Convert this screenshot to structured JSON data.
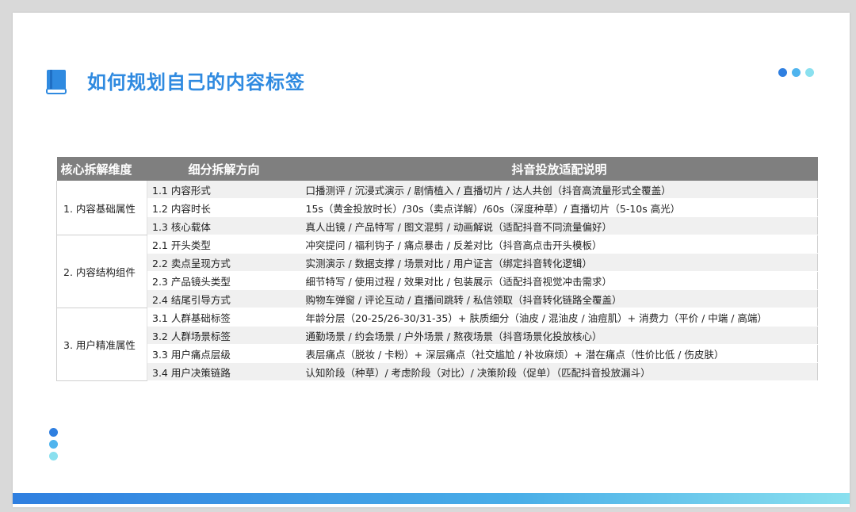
{
  "title": "如何规划自己的内容标签",
  "colors": {
    "accent": "#2f8ae0",
    "dot1": "#2f7fe0",
    "dot2": "#4fb4ee",
    "dot3": "#8ae0ef",
    "header_bg": "#7f7f7f"
  },
  "icons": {
    "title_icon": "book-icon"
  },
  "table": {
    "headers": [
      "核心拆解维度",
      "细分拆解方向",
      "抖音投放适配说明"
    ],
    "groups": [
      {
        "label": "1. 内容基础属性",
        "rows": [
          {
            "sub": "1.1 内容形式",
            "desc": "口播测评 / 沉浸式演示 / 剧情植入 / 直播切片 / 达人共创（抖音高流量形式全覆盖）"
          },
          {
            "sub": "1.2 内容时长",
            "desc": "15s（黄金投放时长）/30s（卖点详解）/60s（深度种草）/ 直播切片（5-10s 高光）"
          },
          {
            "sub": "1.3 核心载体",
            "desc": "真人出镜 / 产品特写 / 图文混剪 / 动画解说（适配抖音不同流量偏好）"
          }
        ]
      },
      {
        "label": "2. 内容结构组件",
        "rows": [
          {
            "sub": "2.1 开头类型",
            "desc": "冲突提问 / 福利钩子 / 痛点暴击 / 反差对比（抖音高点击开头模板）"
          },
          {
            "sub": "2.2 卖点呈现方式",
            "desc": "实测演示 / 数据支撑 / 场景对比 / 用户证言（绑定抖音转化逻辑）"
          },
          {
            "sub": "2.3 产品镜头类型",
            "desc": "细节特写 / 使用过程 / 效果对比 / 包装展示（适配抖音视觉冲击需求）"
          },
          {
            "sub": "2.4 结尾引导方式",
            "desc": "购物车弹窗 / 评论互动 / 直播间跳转 / 私信领取（抖音转化链路全覆盖）"
          }
        ]
      },
      {
        "label": "3. 用户精准属性",
        "rows": [
          {
            "sub": "3.1 人群基础标签",
            "desc": "年龄分层（20-25/26-30/31-35）+ 肤质细分（油皮 / 混油皮 / 油痘肌）+ 消费力（平价 / 中端 / 高端）"
          },
          {
            "sub": "3.2 人群场景标签",
            "desc": "通勤场景 / 约会场景 / 户外场景 / 熬夜场景（抖音场景化投放核心）"
          },
          {
            "sub": "3.3 用户痛点层级",
            "desc": "表层痛点（脱妆 / 卡粉）+ 深层痛点（社交尴尬 / 补妆麻烦）+ 潜在痛点（性价比低 / 伤皮肤）"
          },
          {
            "sub": "3.4 用户决策链路",
            "desc": "认知阶段（种草）/ 考虑阶段（对比）/ 决策阶段（促单）（匹配抖音投放漏斗）"
          }
        ]
      }
    ]
  }
}
